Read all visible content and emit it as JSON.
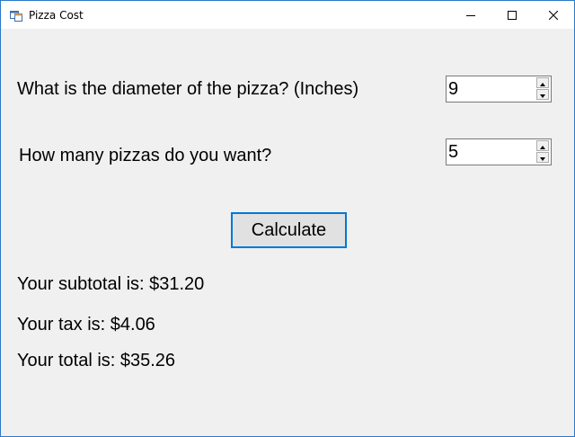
{
  "window": {
    "title": "Pizza Cost"
  },
  "form": {
    "diameter_label": "What is the diameter of the pizza? (Inches)",
    "diameter_value": "9",
    "count_label": "How many pizzas do you want?",
    "count_value": "5",
    "calculate_label": "Calculate",
    "subtotal_text": "Your subtotal is: $31.20",
    "tax_text": "Your tax is: $4.06",
    "total_text": "Your total is: $35.26"
  },
  "colors": {
    "accent": "#0078d7",
    "window_border": "#2b79c9",
    "form_background": "#f0f0f0"
  },
  "icons": {
    "app": "winforms-app-icon",
    "minimize": "minimize-icon",
    "maximize": "maximize-icon",
    "close": "close-icon"
  }
}
